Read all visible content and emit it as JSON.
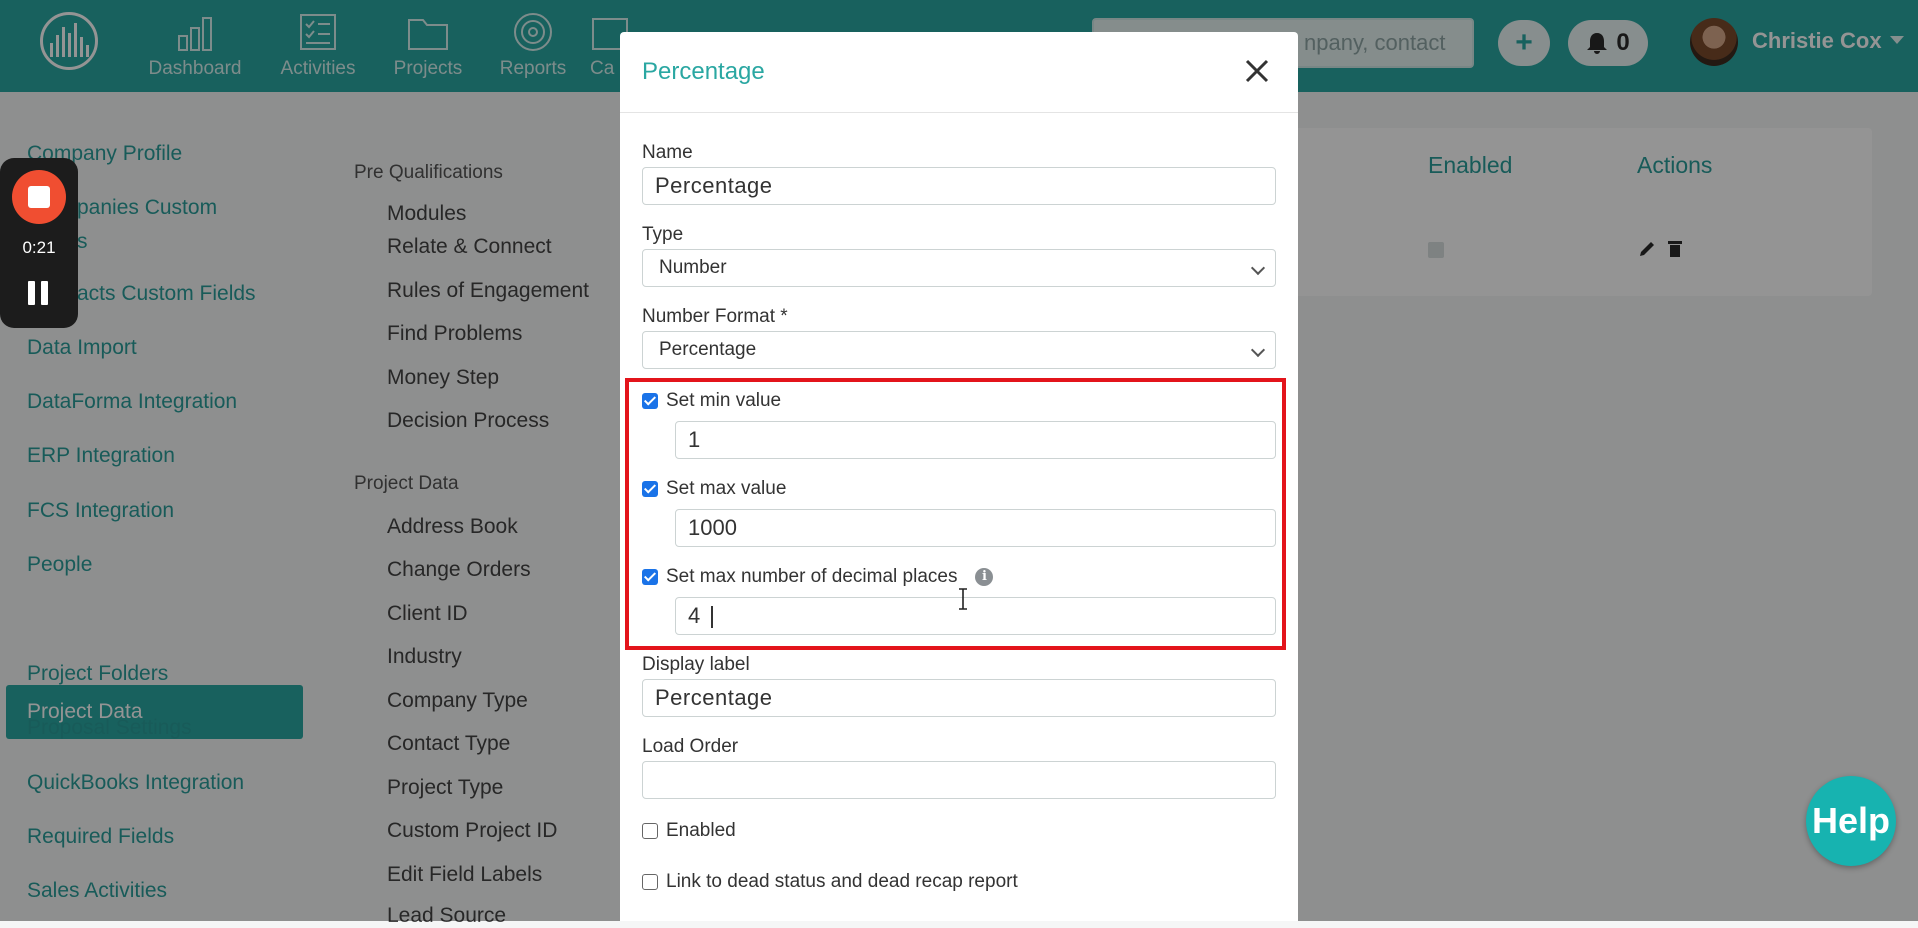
{
  "nav": {
    "items": [
      "Dashboard",
      "Activities",
      "Projects",
      "Reports",
      "Ca"
    ],
    "search_placeholder": "Search project, company, contact",
    "search_visible": "npany, contact",
    "add_label": "+",
    "notifications_count": "0",
    "user_name": "Christie Cox"
  },
  "sidebar": {
    "items": [
      "Company Profile",
      "Companies Custom Fields",
      "Contacts Custom Fields",
      "Data Import",
      "DataForma Integration",
      "ERP Integration",
      "FCS Integration",
      "People",
      "Project Data",
      "Project Folders",
      "Proposal Settings",
      "QuickBooks Integration",
      "Required Fields",
      "Sales Activities"
    ],
    "visible": [
      "Company Profile",
      "panies Custom",
      "s",
      "acts Custom Fields",
      "Data Import",
      "DataForma Integration",
      "ERP Integration",
      "FCS Integration",
      "People",
      "Project Data",
      "Project Folders",
      "Proposal Settings",
      "QuickBooks Integration",
      "Required Fields",
      "Sales Activities"
    ],
    "active": "Project Data"
  },
  "middle": {
    "pre_qualifications_heading": "Pre Qualifications",
    "pre_qualifications": [
      "Modules",
      "Relate & Connect",
      "Rules of Engagement",
      "Find Problems",
      "Money Step",
      "Decision Process"
    ],
    "project_data_heading": "Project Data",
    "project_data": [
      "Address Book",
      "Change Orders",
      "Client ID",
      "Industry",
      "Company Type",
      "Contact Type",
      "Project Type",
      "Custom Project ID",
      "Edit Field Labels",
      "Lead Source"
    ]
  },
  "table": {
    "headers": [
      "Enabled",
      "Actions"
    ]
  },
  "recorder": {
    "time": "0:21"
  },
  "modal": {
    "title": "Percentage",
    "name_label": "Name",
    "name_value": "Percentage",
    "type_label": "Type",
    "type_value": "Number",
    "number_format_label": "Number Format *",
    "number_format_value": "Percentage",
    "min_label": "Set min value",
    "min_value": "1",
    "max_label": "Set max value",
    "max_value": "1000",
    "decimals_label": "Set max number of decimal places",
    "decimals_value": "4",
    "display_label_label": "Display label",
    "display_label_value": "Percentage",
    "load_order_label": "Load Order",
    "load_order_value": "",
    "enabled_label": "Enabled",
    "dead_status_label": "Link to dead status and dead recap report"
  },
  "help": {
    "label": "Help"
  },
  "colors": {
    "teal": "#2aa7a2",
    "highlight_red": "#e3141b",
    "checkbox_blue": "#1a73e8"
  }
}
